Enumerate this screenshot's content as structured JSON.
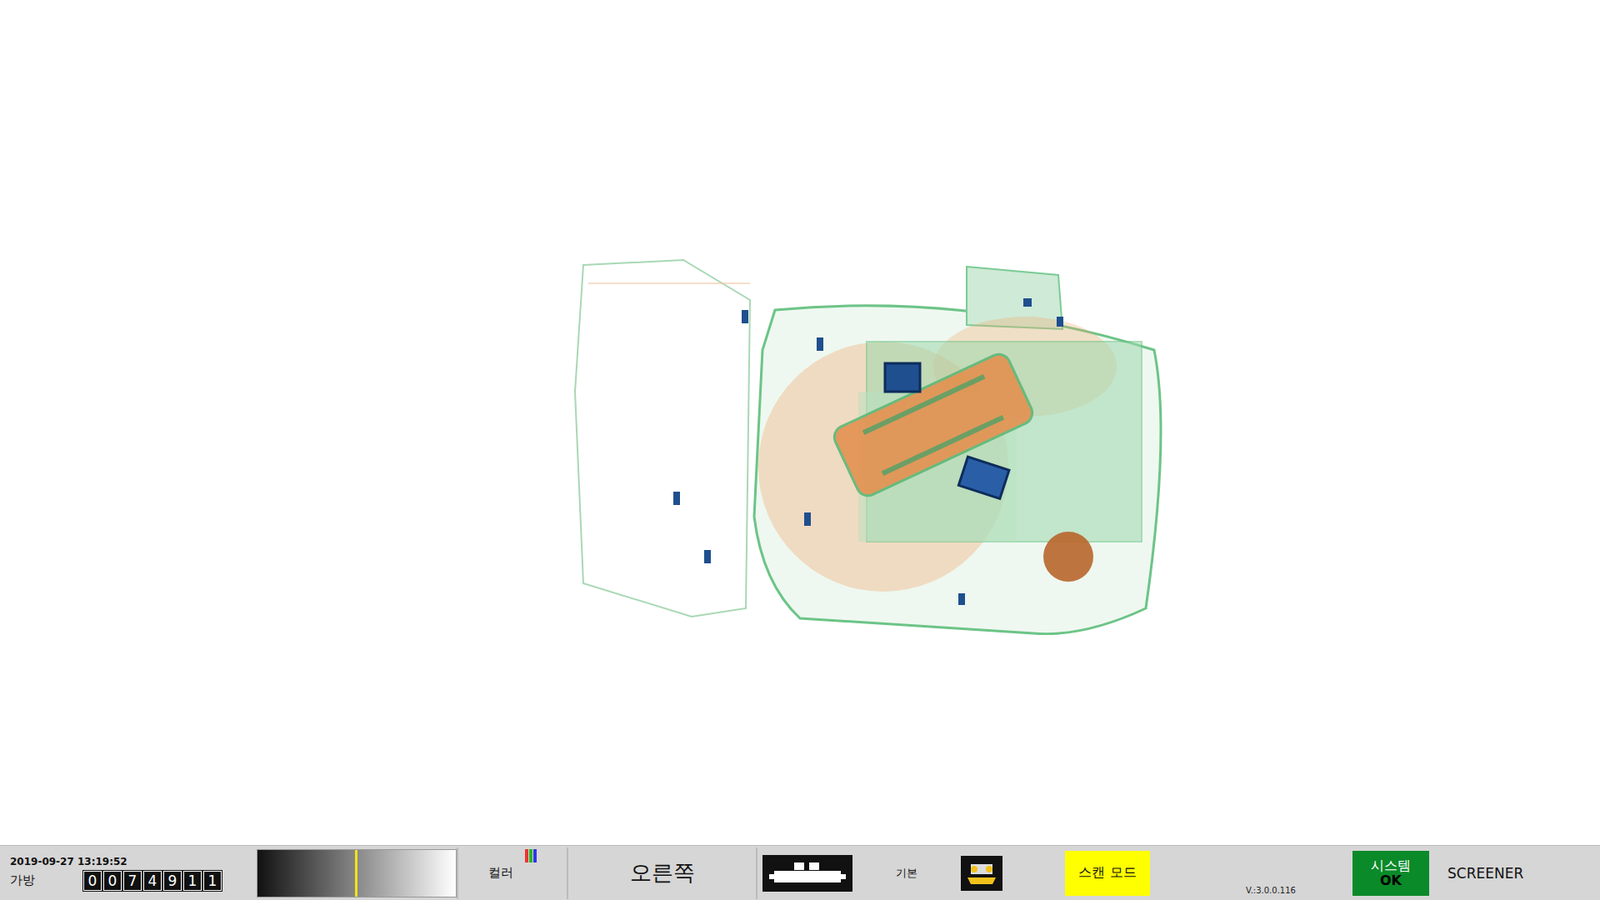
{
  "status_bar": {
    "datetime": "2019-09-27 13:19:52",
    "bag_label": "가방",
    "bag_counter": "0074911",
    "density": {
      "level": 0.49
    },
    "color_mode": "컬러",
    "direction": "오른쪽",
    "view": "기본",
    "scan_mode": {
      "label": "스캔 모드",
      "active": true
    },
    "version": "V.:3.0.0.116",
    "system": {
      "label": "시스템",
      "status": "OK",
      "ok": true
    },
    "user": "SCREENER"
  }
}
